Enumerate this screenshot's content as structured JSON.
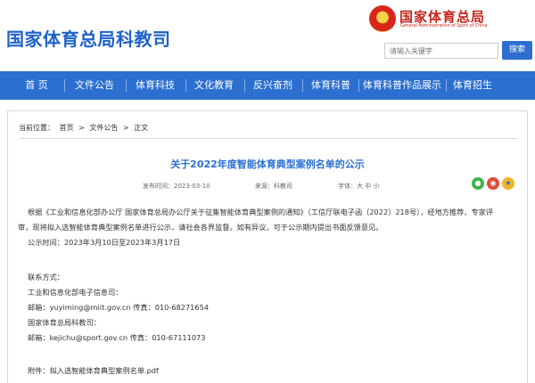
{
  "header": {
    "site_title": "国家体育总局科教司",
    "brand_cn": "国家体育总局",
    "brand_en": "General Administration of Sport of China",
    "search_placeholder": "请输入关键字",
    "search_button": "搜索"
  },
  "nav": {
    "items": [
      "首 页",
      "文件公告",
      "体育科技",
      "文化教育",
      "反兴奋剂",
      "体育科普",
      "体育科普作品展示",
      "体育招生"
    ],
    "color": "#2b6fd0"
  },
  "breadcrumb": {
    "label": "当前位置：",
    "items": [
      "首页",
      ">",
      "文件公告",
      ">",
      "正文"
    ]
  },
  "article": {
    "title": "关于2022年度智能体育典型案例名单的公示",
    "date": "发布时间：2023-03-10",
    "source": "来源：科教司",
    "font_size": "字体：大  中  小",
    "share_icons": [
      "wechat-icon",
      "weibo-icon",
      "favorite-icon"
    ],
    "paragraph1_line1": "根据《工业和信息化部办公厅 国家体育总局办公厅关于征集智能体育典型案例的通知》（工信厅联电子函〔2022〕218号），经地方推荐、专家评",
    "paragraph1_line2": "审，现将拟入选智能体育典型案例名单进行公示，请社会各界监督。如有异议，可于公示期内提出书面反馈意见。",
    "period": "公示时间：2023年3月10日至2023年3月17日",
    "contact_label": "联系方式：",
    "org1": "工业和信息化部电子信息司：",
    "org1_contact": "邮箱：yuyiming@miit.gov.cn  传真：010-68271654",
    "org2": "国家体育总局科教司：",
    "org2_contact": "邮箱：kejichu@sport.gov.cn  传真：010-67111073",
    "attachment": "附件：拟入选智能体育典型案例名单.pdf"
  }
}
